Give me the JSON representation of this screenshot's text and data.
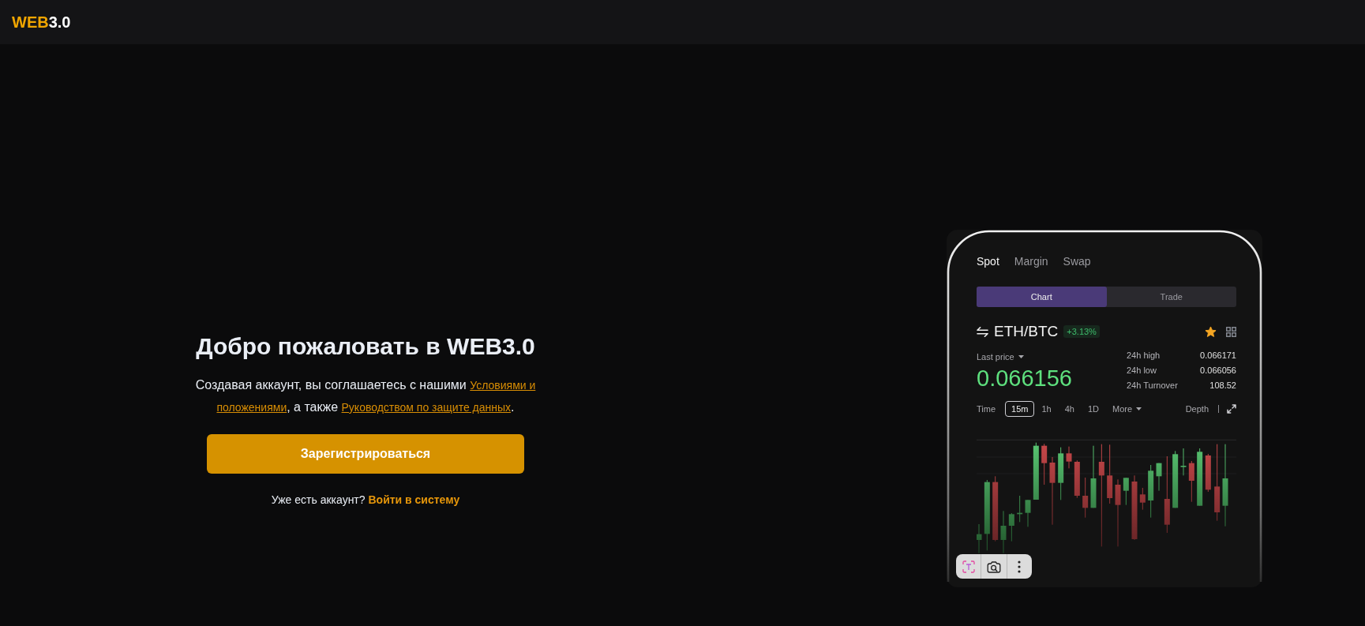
{
  "header": {
    "logo": {
      "accent": "WEB",
      "rest": "3.0"
    }
  },
  "welcome": {
    "title": "Добро пожаловать в WEB3.0",
    "terms": [
      {
        "kind": "text",
        "text": "Создавая аккаунт, вы соглашаетесь с нашими "
      },
      {
        "kind": "link",
        "text": "Условиями и"
      },
      {
        "kind": "link",
        "text": "положениями"
      },
      {
        "kind": "text",
        "text": ", а также "
      },
      {
        "kind": "link",
        "text": "Руководством по защите данных"
      },
      {
        "kind": "text",
        "text": "."
      }
    ],
    "register_button": "Зарегистрироваться",
    "login_prompt": "Уже есть аккаунт?",
    "login_link": "Войти в систему"
  },
  "app_preview": {
    "market_tabs": [
      {
        "label": "Spot",
        "selected": true
      },
      {
        "label": "Margin",
        "selected": false
      },
      {
        "label": "Swap",
        "selected": false
      }
    ],
    "view_switch": [
      {
        "label": "Chart",
        "selected": true
      },
      {
        "label": "Trade",
        "selected": false
      }
    ],
    "pair": "ETH/BTC",
    "change": "+3.13%",
    "favorite": true,
    "last_price_label": "Last price",
    "last_price": "0.066156",
    "stats": [
      {
        "label": "24h high",
        "value": "0.066171"
      },
      {
        "label": "24h low",
        "value": "0.066056"
      },
      {
        "label": "24h Turnover",
        "value": "108.52"
      }
    ],
    "intervals": {
      "label": "Time",
      "options": [
        {
          "label": "15m",
          "selected": true
        },
        {
          "label": "1h",
          "selected": false
        },
        {
          "label": "4h",
          "selected": false
        },
        {
          "label": "1D",
          "selected": false
        }
      ],
      "more": "More"
    },
    "depth": "Depth"
  },
  "image_toolbar": {
    "buttons": [
      {
        "kind": "text-select"
      },
      {
        "kind": "visual-search"
      },
      {
        "kind": "more"
      }
    ]
  }
}
